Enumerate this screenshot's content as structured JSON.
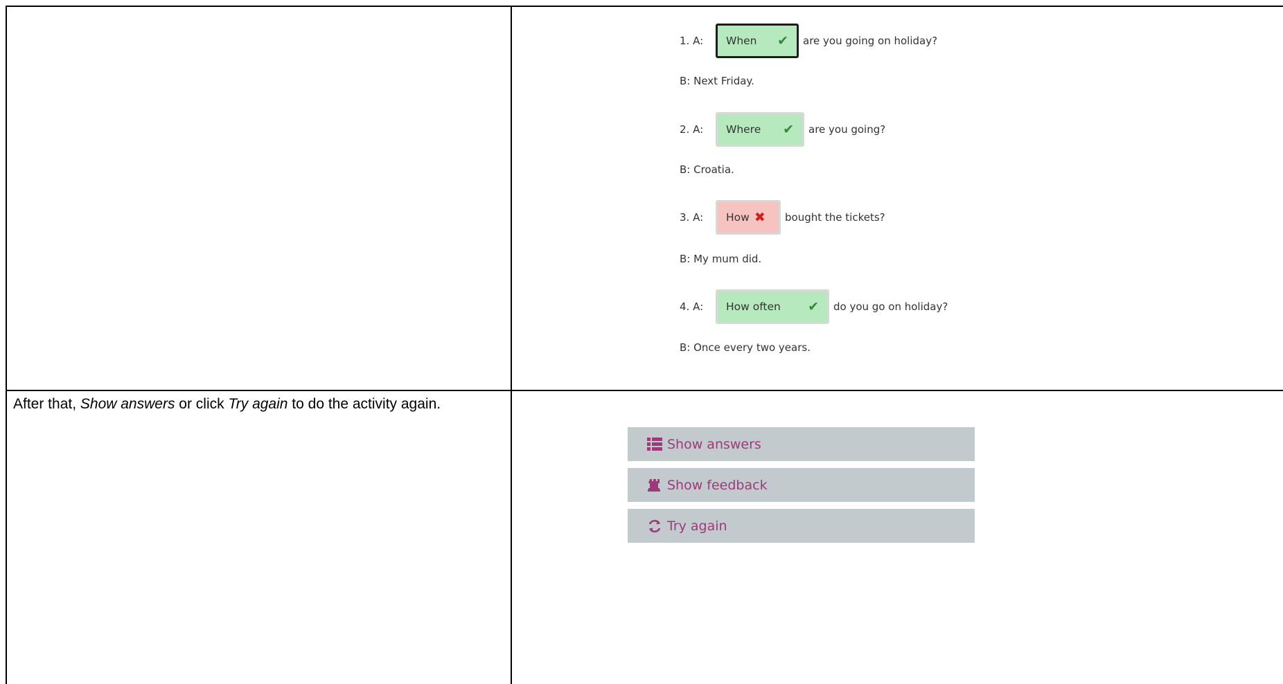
{
  "instruction": {
    "part1": "After that, ",
    "em1": "Show answers",
    "part2": " or click ",
    "em2": "Try again",
    "part3": " to do the activity again."
  },
  "questions": [
    {
      "prefix": "1. A:",
      "answer": "When",
      "status": "correct",
      "after": "are you going on holiday?",
      "reply": "B: Next Friday.",
      "focused": true
    },
    {
      "prefix": "2. A:",
      "answer": "Where",
      "status": "correct",
      "after": "are you going?",
      "reply": "B: Croatia.",
      "focused": false
    },
    {
      "prefix": "3. A:",
      "answer": "How",
      "status": "wrong",
      "after": "bought the tickets?",
      "reply": "B: My mum did.",
      "focused": false
    },
    {
      "prefix": "4. A:",
      "answer": "How often",
      "status": "correct",
      "after": "do you go on holiday?",
      "reply": "B: Once every two years.",
      "focused": false
    }
  ],
  "buttons": {
    "show_answers": {
      "label": "Show answers",
      "icon": "list-icon"
    },
    "show_feedback": {
      "label": "Show feedback",
      "icon": "rook-icon"
    },
    "try_again": {
      "label": "Try again",
      "icon": "refresh-icon"
    }
  },
  "colors": {
    "correct_bg": "#b6e9bd",
    "wrong_bg": "#f7c3c0",
    "button_bg": "#c3cacd",
    "button_text": "#9c3a7a",
    "check": "#2f8a3a",
    "cross": "#d0201a"
  }
}
